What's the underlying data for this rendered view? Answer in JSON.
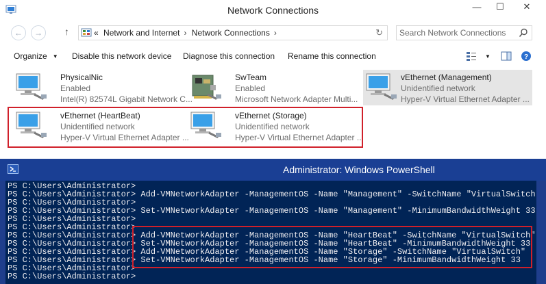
{
  "explorer": {
    "title": "Network Connections",
    "caption": {
      "minimize": "—",
      "maximize": "☐",
      "close": "✕"
    },
    "nav": {
      "back": "←",
      "forward": "→",
      "up": "↑",
      "crumb_prefix": "«",
      "crumbs": [
        "Network and Internet",
        "Network Connections"
      ],
      "crumb_sep": "›",
      "refresh": "↻",
      "search_placeholder": "Search Network Connections"
    },
    "commands": {
      "organize": "Organize",
      "organize_caret": "▼",
      "disable": "Disable this network device",
      "diagnose": "Diagnose this connection",
      "rename": "Rename this connection",
      "view_caret": "▼"
    },
    "items": [
      {
        "name": "PhysicalNic",
        "status": "Enabled",
        "device": "Intel(R) 82574L Gigabit Network C...",
        "icon": "network-adapter-icon"
      },
      {
        "name": "SwTeam",
        "status": "Enabled",
        "device": "Microsoft Network Adapter Multi...",
        "icon": "network-card-icon"
      },
      {
        "name": "vEthernet (Management)",
        "status": "Unidentified network",
        "device": "Hyper-V Virtual Ethernet Adapter ...",
        "icon": "network-adapter-icon"
      },
      {
        "name": "vEthernet (HeartBeat)",
        "status": "Unidentified network",
        "device": "Hyper-V Virtual Ethernet Adapter ...",
        "icon": "network-adapter-icon"
      },
      {
        "name": "vEthernet (Storage)",
        "status": "Unidentified network",
        "device": "Hyper-V Virtual Ethernet Adapter ...",
        "icon": "network-card-icon"
      }
    ]
  },
  "powershell": {
    "title": "Administrator: Windows PowerShell",
    "lines": [
      "PS C:\\Users\\Administrator>",
      "PS C:\\Users\\Administrator> Add-VMNetworkAdapter -ManagementOS -Name \"Management\" -SwitchName \"VirtualSwitch\"",
      "PS C:\\Users\\Administrator>",
      "PS C:\\Users\\Administrator> Set-VMNetworkAdapter -ManagementOS -Name \"Management\" -MinimumBandwidthWeight 33",
      "PS C:\\Users\\Administrator>",
      "PS C:\\Users\\Administrator>",
      "PS C:\\Users\\Administrator> Add-VMNetworkAdapter -ManagementOS -Name \"HeartBeat\" -SwitchName \"VirtualSwitch\"",
      "PS C:\\Users\\Administrator> Set-VMNetworkAdapter -ManagementOS -Name \"HeartBeat\" -MinimumBandwidthWeight 33",
      "PS C:\\Users\\Administrator> Add-VMNetworkAdapter -ManagementOS -Name \"Storage\" -SwitchName \"VirtualSwitch\"",
      "PS C:\\Users\\Administrator> Set-VMNetworkAdapter -ManagementOS -Name \"Storage\" -MinimumBandwidthWeight 33",
      "PS C:\\Users\\Administrator>",
      "PS C:\\Users\\Administrator>"
    ]
  },
  "colors": {
    "highlight_box": "#d0202a",
    "console_bg": "#012456",
    "ps_titlebar": "#1a3f94"
  }
}
